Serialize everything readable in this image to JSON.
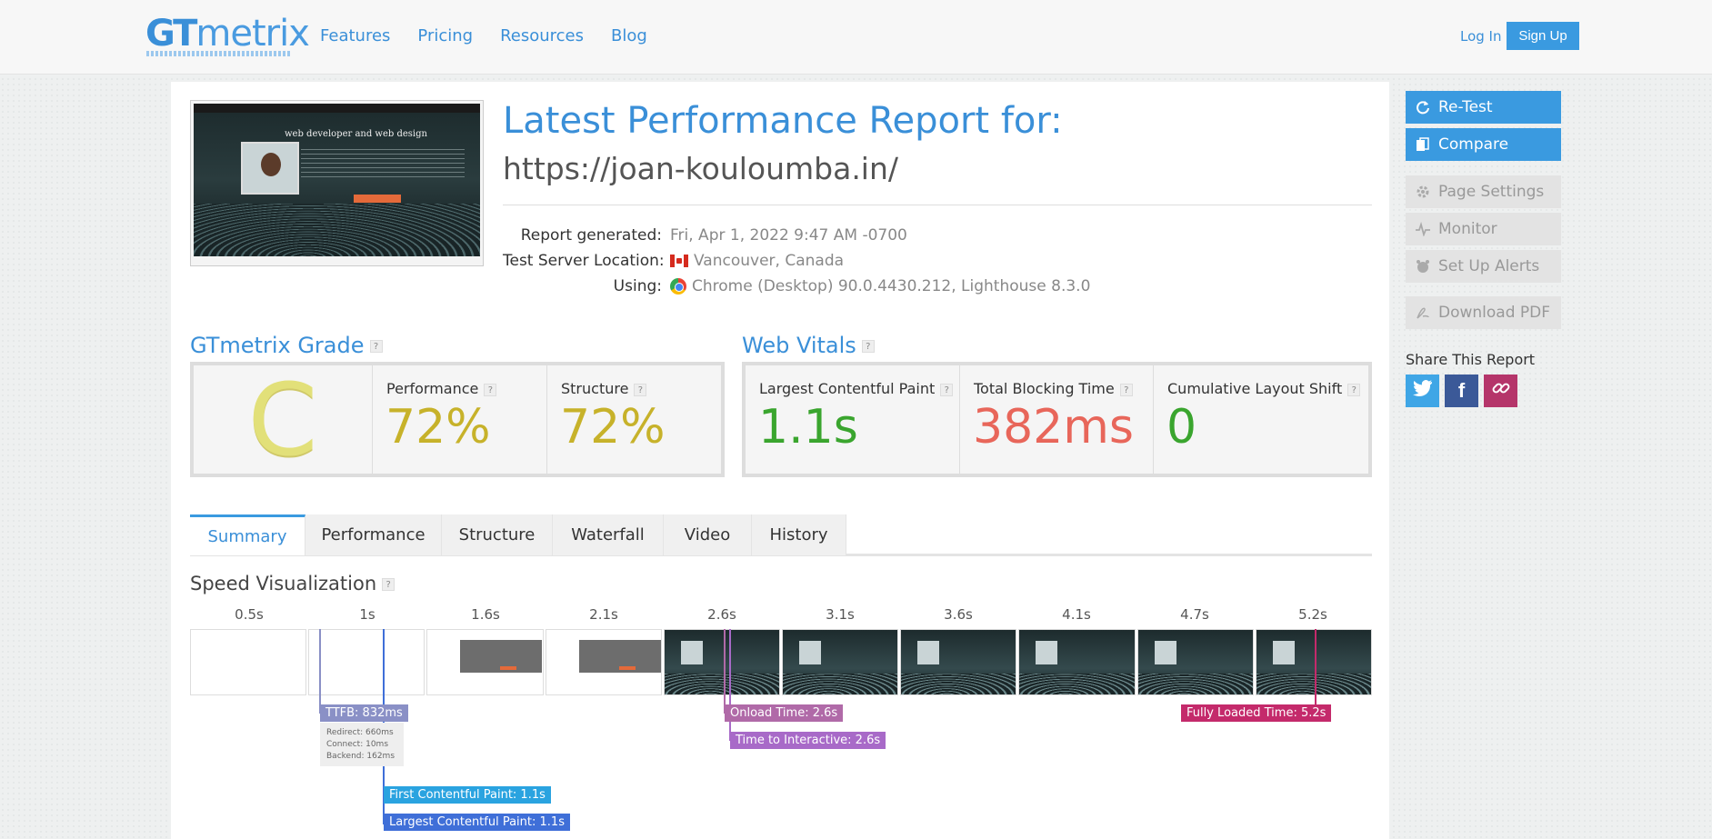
{
  "header": {
    "logo_gt": "GT",
    "logo_metrix": "metrix",
    "nav": [
      "Features",
      "Pricing",
      "Resources",
      "Blog"
    ],
    "login": "Log In",
    "signup": "Sign Up"
  },
  "screenshot": {
    "site_title": "web developer and web design"
  },
  "report": {
    "heading": "Latest Performance Report for:",
    "url": "https://joan-kouloumba.in/",
    "generated_label": "Report generated:",
    "generated_value": "Fri, Apr 1, 2022 9:47 AM -0700",
    "location_label": "Test Server Location:",
    "location_value": "Vancouver, Canada",
    "using_label": "Using:",
    "using_value": "Chrome (Desktop) 90.0.4430.212, Lighthouse 8.3.0"
  },
  "grade": {
    "title": "GTmetrix Grade",
    "letter": "C",
    "performance_label": "Performance",
    "performance_value": "72%",
    "structure_label": "Structure",
    "structure_value": "72%"
  },
  "vitals": {
    "title": "Web Vitals",
    "lcp_label": "Largest Contentful Paint",
    "lcp_value": "1.1s",
    "tbt_label": "Total Blocking Time",
    "tbt_value": "382ms",
    "cls_label": "Cumulative Layout Shift",
    "cls_value": "0",
    "colors": {
      "good": "#3aa52e",
      "bad": "#e8665a"
    }
  },
  "tabs": [
    "Summary",
    "Performance",
    "Structure",
    "Waterfall",
    "Video",
    "History"
  ],
  "speed": {
    "title": "Speed Visualization",
    "ticks": [
      "0.5s",
      "1s",
      "1.6s",
      "2.1s",
      "2.6s",
      "3.1s",
      "3.6s",
      "4.1s",
      "4.7s",
      "5.2s"
    ],
    "ttfb": "TTFB: 832ms",
    "redirect": "Redirect: 660ms",
    "connect": "Connect: 10ms",
    "backend": "Backend: 162ms",
    "onload": "Onload Time: 2.6s",
    "tti": "Time to Interactive: 2.6s",
    "fully_loaded": "Fully Loaded Time: 5.2s",
    "fcp": "First Contentful Paint: 1.1s",
    "lcp": "Largest Contentful Paint: 1.1s"
  },
  "sidebar": {
    "retest": "Re-Test",
    "compare": "Compare",
    "page_settings": "Page Settings",
    "monitor": "Monitor",
    "alerts": "Set Up Alerts",
    "download": "Download PDF",
    "share_title": "Share This Report"
  }
}
